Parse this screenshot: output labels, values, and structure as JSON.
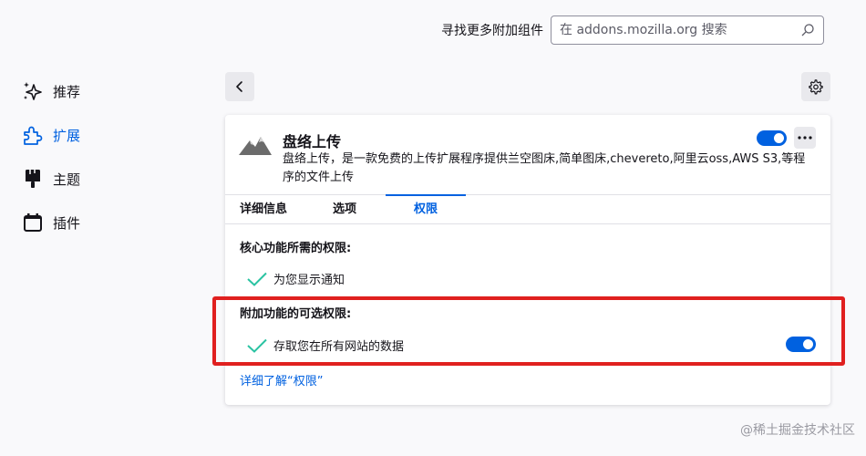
{
  "header": {
    "find_more_label": "寻找更多附加组件",
    "search_placeholder": "在 addons.mozilla.org 搜索"
  },
  "sidebar": {
    "items": [
      {
        "label": "推荐",
        "icon": "sparkles-icon"
      },
      {
        "label": "扩展",
        "icon": "puzzle-icon",
        "active": true
      },
      {
        "label": "主题",
        "icon": "paintbrush-icon"
      },
      {
        "label": "插件",
        "icon": "plugin-icon"
      }
    ]
  },
  "addon": {
    "name": "盘络上传",
    "description": "盘络上传，是一款免费的上传扩展程序提供兰空图床,简单图床,chevereto,阿里云oss,AWS S3,等程序的文件上传",
    "enabled": true
  },
  "tabs": [
    {
      "label": "详细信息"
    },
    {
      "label": "选项"
    },
    {
      "label": "权限",
      "active": true
    }
  ],
  "permissions": {
    "required_title": "核心功能所需的权限:",
    "required": [
      {
        "label": "为您显示通知"
      }
    ],
    "optional_title": "附加功能的可选权限:",
    "optional": [
      {
        "label": "存取您在所有网站的数据",
        "enabled": true
      }
    ],
    "learn_more": "详细了解“权限”"
  },
  "colors": {
    "accent": "#0061e0",
    "check": "#2ac3a2",
    "highlight": "#e0201f"
  },
  "watermark": "@稀土掘金技术社区"
}
